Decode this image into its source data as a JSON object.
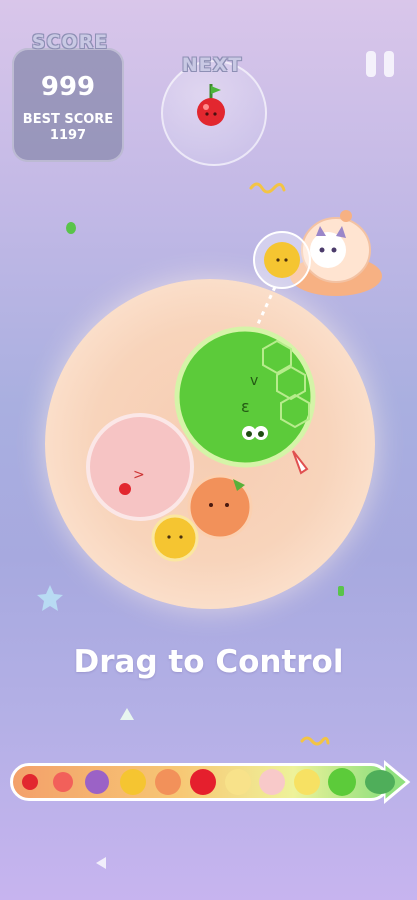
{
  "hud": {
    "score_label": "SCORE",
    "score": "999",
    "best_label": "BEST SCORE",
    "best_score": "1197",
    "next_label": "NEXT"
  },
  "hint": "Drag to Control",
  "icons": {
    "pause": "pause-icon",
    "next_fruit": "cherry-icon",
    "spaceship": "cat-ufo-icon"
  },
  "colors": {
    "orb": "#f8d4bb",
    "watermelon": "#5ccb3a",
    "peach": "#f7c3c3",
    "orange": "#f2915a",
    "lemon": "#f5c531",
    "cherry": "#e2272f"
  },
  "evolution_bar": [
    "cherry",
    "strawberry",
    "grape",
    "lemon",
    "orange",
    "apple",
    "pear",
    "peach",
    "pineapple",
    "melon",
    "watermelon"
  ]
}
